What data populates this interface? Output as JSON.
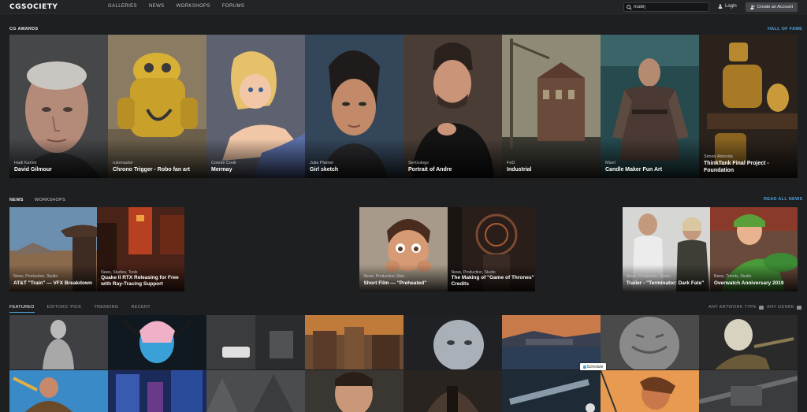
{
  "header": {
    "logo": "CGSOCIETY",
    "nav": [
      "GALLERIES",
      "NEWS",
      "WORKSHOPS",
      "FORUMS"
    ],
    "search_value": "nude|",
    "login_label": "Login",
    "create_account_label": "Create an Account"
  },
  "awards": {
    "title": "CG AWARDS",
    "link": "HALL OF FAME",
    "items": [
      {
        "author": "Hadi Karimi",
        "title": "David Gilmour"
      },
      {
        "author": "rulomaster",
        "title": "Chrono Trigger - Robo fan art"
      },
      {
        "author": "Connie Cook",
        "title": "Mermay"
      },
      {
        "author": "Julia Plamer",
        "title": "Girl sketch"
      },
      {
        "author": "SerGologs",
        "title": "Portrait of Andre"
      },
      {
        "author": "FeD",
        "title": "Industrial"
      },
      {
        "author": "Mizel",
        "title": "Candle Maker Fun Art"
      },
      {
        "author": "Simon Almeida",
        "title": "ThinkTank Final Project - Foundation"
      }
    ]
  },
  "news": {
    "tabs": [
      "NEWS",
      "WORKSHOPS"
    ],
    "link": "READ ALL NEWS",
    "items": [
      {
        "category": "News, Production, Studio",
        "title": "AT&T \"Train\" — VFX Breakdown"
      },
      {
        "category": "News, Studios, Tools",
        "title": "Quake II RTX Releasing for Free with Ray-Tracing Support"
      },
      {
        "category": "News, Production, Misc",
        "title": "Short Film — \"Preheated\""
      },
      {
        "category": "News, Production, Studio",
        "title": "The Making of \"Game of Thrones\" Credits"
      },
      {
        "category": "News, Production, Studio",
        "title": "Trailer - \"Terminator: Dark Fate\""
      },
      {
        "category": "News, Trends, Studio",
        "title": "Overwatch Anniversary 2019"
      }
    ]
  },
  "gallery": {
    "tabs": [
      "FEATURED",
      "EDITORS' PICK",
      "TRENDING",
      "RECENT"
    ],
    "filter_type": "ANY ARTWORK TYPE",
    "filter_genre": "ANY GENRE",
    "schedule_label": "Schedule"
  },
  "colors": {
    "accent": "#4ea0d8",
    "background": "#1e1f21"
  }
}
